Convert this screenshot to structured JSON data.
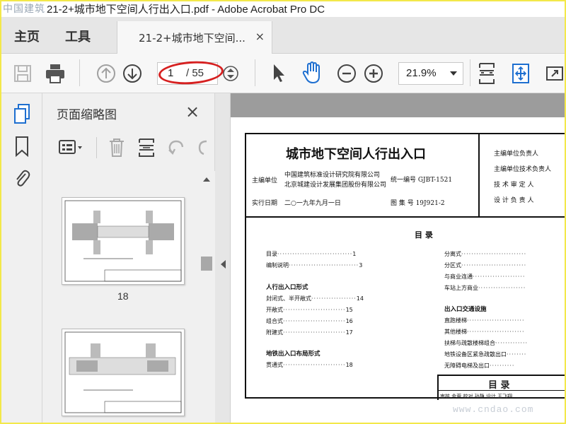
{
  "window": {
    "brand_watermark": "中国建筑",
    "title": "21-2+城市地下空间人行出入口.pdf - Adobe Acrobat Pro DC"
  },
  "menu": {
    "home": "主页",
    "tools": "工具",
    "doc_tab": "21-2+城市地下空间...",
    "doc_tab_close": "×"
  },
  "toolbar": {
    "current_page": "1",
    "total_pages": "/ 55",
    "zoom": "21.9%",
    "icons": [
      "save-icon",
      "print-icon",
      "page-up-icon",
      "page-down-icon",
      "page-stepper-icon",
      "select-cursor-icon",
      "hand-tool-icon",
      "zoom-out-icon",
      "zoom-in-icon",
      "fit-page-icon",
      "scroll-mode-icon",
      "fullscreen-icon"
    ]
  },
  "left_rail": {
    "icons": [
      "page-thumbnails-icon",
      "bookmarks-icon",
      "attachments-icon"
    ]
  },
  "thumbnail_panel": {
    "title": "页面缩略图",
    "close": "×",
    "tools": [
      "options-icon",
      "delete-page-icon",
      "extract-page-icon",
      "undo-icon",
      "redo-icon"
    ],
    "thumbnails": [
      {
        "label": "18"
      },
      {
        "label": ""
      }
    ]
  },
  "document": {
    "title": "城市地下空间人行出入口",
    "editor_label": "主编单位",
    "editor_1": "中国建筑标准设计研究院有限公司",
    "editor_2": "北京城建设计发展集团股份有限公司",
    "unified_number": "统一编号 GJBT-1521",
    "date_label": "实行日期",
    "date_value": "二○一九年九月一日",
    "atlas_number": "图 集 号 19J921-2",
    "right_lines": [
      "主编单位负责人",
      "主编单位技术负责人",
      "技 术 审 定 人",
      "设 计 负 责 人"
    ],
    "toc_heading": "目      录",
    "toc_left": [
      {
        "label": "目录",
        "page": "1"
      },
      {
        "label": "编制说明",
        "page": "3"
      }
    ],
    "section_1": "人行出入口形式",
    "toc_section_1": [
      {
        "label": "封闭式、半开敞式",
        "page": "14"
      },
      {
        "label": "开敞式",
        "page": "15"
      },
      {
        "label": "组合式",
        "page": "16"
      },
      {
        "label": "附建式",
        "page": "17"
      }
    ],
    "section_2": "地铁出入口布局形式",
    "toc_section_2": [
      {
        "label": "贯通式",
        "page": "18"
      }
    ],
    "toc_right_1": [
      {
        "label": "分离式"
      },
      {
        "label": "分区式"
      },
      {
        "label": "与商业连通"
      },
      {
        "label": "车站上方商业"
      }
    ],
    "section_3": "出入口交通设施",
    "toc_right_2": [
      {
        "label": "直跑楼梯"
      },
      {
        "label": "其他楼梯"
      },
      {
        "label": "扶梯与疏散楼梯组合"
      },
      {
        "label": "地铁设备区紧急疏散出口"
      },
      {
        "label": "无障碍电梯及出口"
      }
    ],
    "bottom_title": "目   录",
    "bottom_row": "审核 金蓉 校对 孙静 设计 王飞翔"
  },
  "watermark": "www.cndao.com"
}
